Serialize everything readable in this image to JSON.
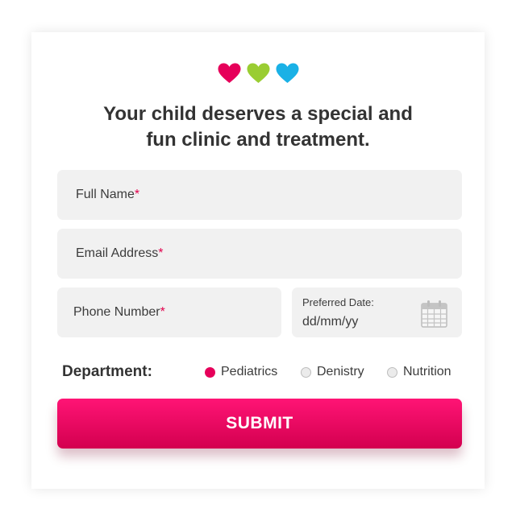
{
  "colors": {
    "heart_pink": "#e6005a",
    "heart_green": "#9acd32",
    "heart_blue": "#1ab1e6",
    "accent": "#e1004c"
  },
  "headline_line1": "Your child deserves a special and",
  "headline_line2": "fun clinic and treatment.",
  "form": {
    "full_name_placeholder": "Full Name",
    "email_placeholder": "Email Address",
    "phone_placeholder": "Phone Number",
    "required_mark": "*",
    "date_label": "Preferred Date:",
    "date_placeholder": "dd/mm/yy",
    "department_label": "Department:",
    "departments": [
      "Pediatrics",
      "Denistry",
      "Nutrition"
    ],
    "selected_department": "Pediatrics",
    "submit_label": "SUBMIT"
  },
  "icons": [
    "heart-icon",
    "calendar-icon"
  ]
}
